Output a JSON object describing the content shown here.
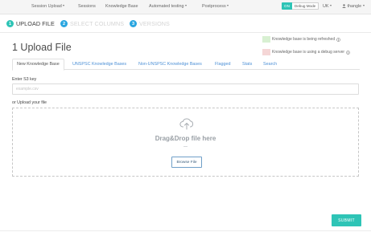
{
  "nav": {
    "items": [
      {
        "label": "Session Upload",
        "dropdown": true
      },
      {
        "label": "Sessions",
        "dropdown": false
      },
      {
        "label": "Knowledge Base",
        "dropdown": false
      },
      {
        "label": "Automated testing",
        "dropdown": true
      },
      {
        "label": "Postprocess",
        "dropdown": true
      }
    ],
    "toggle_on": "ON",
    "toggle_label": "Debug Mode",
    "region": "UK",
    "user": "thangle"
  },
  "steps": [
    {
      "num": "1",
      "label": "UPLOAD FILE",
      "active": true
    },
    {
      "num": "2",
      "label": "SELECT COLUMNS",
      "active": false
    },
    {
      "num": "3",
      "label": "VERSIONS",
      "active": false
    }
  ],
  "page_title": "1 Upload File",
  "legend": [
    {
      "text": "Knowledge base is being refreshed",
      "color": "#d8f0d2"
    },
    {
      "text": "Knowledge base is using a debug server",
      "color": "#f5d6d6"
    }
  ],
  "tabs": [
    {
      "label": "New Knowledge Base",
      "active": true
    },
    {
      "label": "UNSPSC Knowledge Bases",
      "active": false
    },
    {
      "label": "Non-UNSPSC Knowledge Bases",
      "active": false
    },
    {
      "label": "Flagged",
      "active": false
    },
    {
      "label": "Stats",
      "active": false
    },
    {
      "label": "Search",
      "active": false
    }
  ],
  "form": {
    "s3_label": "Enter S3 key",
    "s3_placeholder": "example.csv",
    "upload_label": "or Upload your file",
    "dropzone_title": "Drag&Drop file here",
    "dropzone_or": "—",
    "browse_label": "Browse File",
    "submit_label": "SUBMIT"
  },
  "colors": {
    "accent": "#2ec4b6",
    "step_inactive": "#2aa6e0",
    "link": "#4d90d6"
  }
}
